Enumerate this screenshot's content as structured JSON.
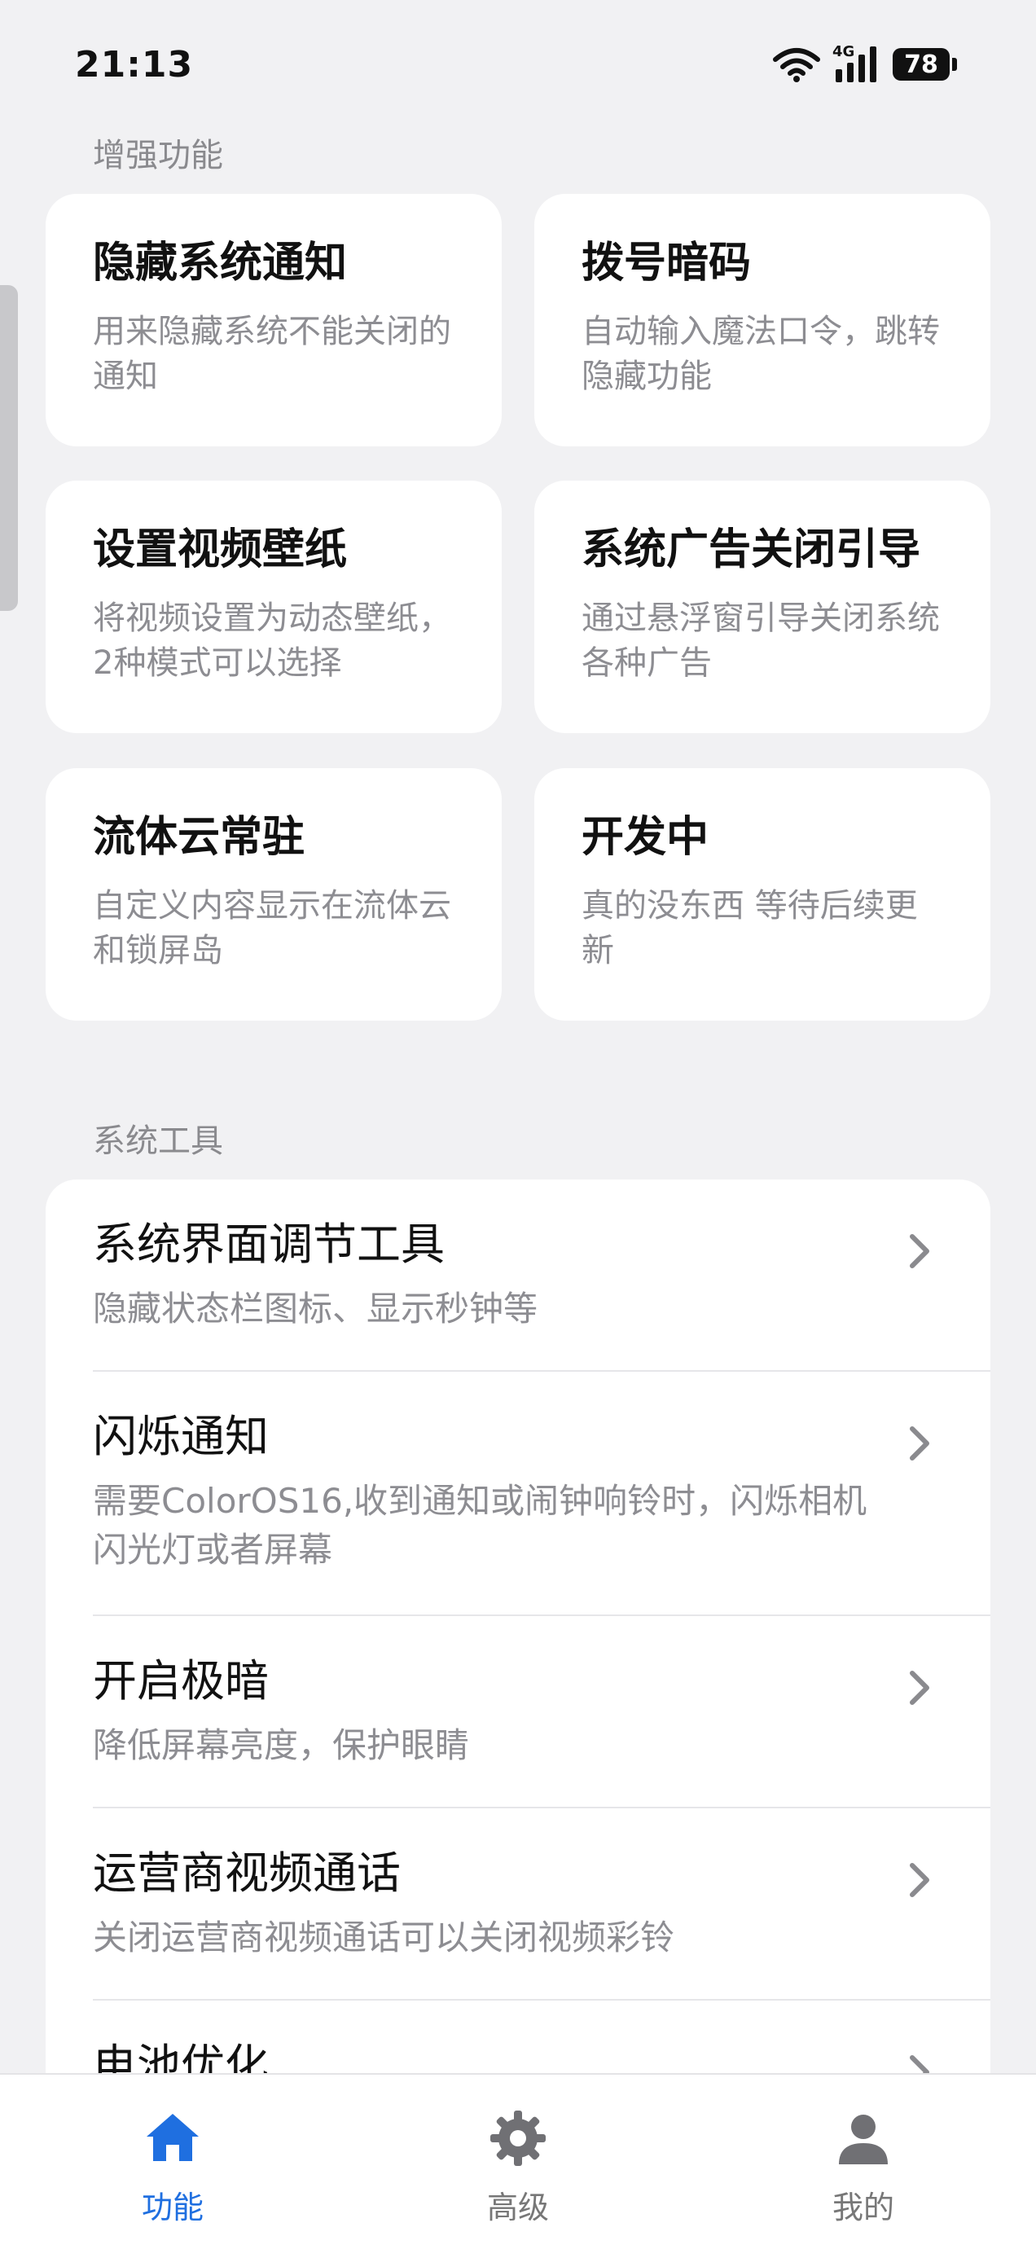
{
  "status_bar": {
    "time": "21:13",
    "network": "4G",
    "battery": "78"
  },
  "sections": {
    "enhanced": "增强功能",
    "system_tools": "系统工具"
  },
  "cards": [
    {
      "title": "隐藏系统通知",
      "desc": "用来隐藏系统不能关闭的通知"
    },
    {
      "title": "拨号暗码",
      "desc": "自动输入魔法口令，跳转隐藏功能"
    },
    {
      "title": "设置视频壁纸",
      "desc": "将视频设置为动态壁纸，2种模式可以选择"
    },
    {
      "title": "系统广告关闭引导",
      "desc": "通过悬浮窗引导关闭系统各种广告"
    },
    {
      "title": "流体云常驻",
      "desc": "自定义内容显示在流体云和锁屏岛"
    },
    {
      "title": "开发中",
      "desc": "真的没东西 等待后续更新"
    }
  ],
  "tools": [
    {
      "title": "系统界面调节工具",
      "desc": "隐藏状态栏图标、显示秒钟等"
    },
    {
      "title": "闪烁通知",
      "desc": "需要ColorOS16,收到通知或闹钟响铃时，闪烁相机闪光灯或者屏幕"
    },
    {
      "title": "开启极暗",
      "desc": "降低屏幕亮度，保护眼睛"
    },
    {
      "title": "运营商视频通话",
      "desc": "关闭运营商视频通话可以关闭视频彩铃"
    },
    {
      "title": "电池优化",
      "desc": ""
    }
  ],
  "nav": {
    "items": [
      {
        "label": "功能",
        "icon": "home-icon"
      },
      {
        "label": "高级",
        "icon": "gear-icon"
      },
      {
        "label": "我的",
        "icon": "person-icon"
      }
    ],
    "active_index": 0
  },
  "colors": {
    "accent": "#1f6fe0",
    "background": "#f1f1f3",
    "card": "#ffffff",
    "secondary_text": "#8d8d92"
  }
}
